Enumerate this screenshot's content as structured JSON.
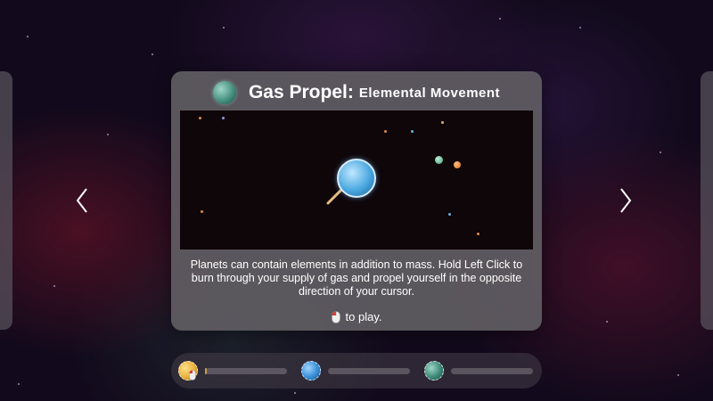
{
  "level_card": {
    "title": "Gas Propel:",
    "subtitle": "Elemental Movement",
    "title_icon": "teal-gas-planet-icon",
    "description": "Planets can contain elements in addition to mass. Hold Left Click to burn through your supply of gas and propel yourself in the opposite direction of your cursor.",
    "play_prompt": "to play.",
    "play_icon": "mouse-left-click-icon"
  },
  "navigation": {
    "prev_icon": "chevron-left-icon",
    "next_icon": "chevron-right-icon"
  },
  "level_selector": {
    "levels": [
      {
        "icon": "yellow-planet-icon",
        "color": "#e8b23c",
        "progress": 0.02,
        "selected": true
      },
      {
        "icon": "blue-planet-icon",
        "color": "#3a8fd6",
        "progress": 0.0,
        "selected": false
      },
      {
        "icon": "teal-planet-icon",
        "color": "#3f8a7a",
        "progress": 0.0,
        "selected": false
      }
    ]
  },
  "colors": {
    "card_bg": "#625e64",
    "accent_progress": "#c9a24a",
    "player_planet": "#4aa8e0"
  }
}
